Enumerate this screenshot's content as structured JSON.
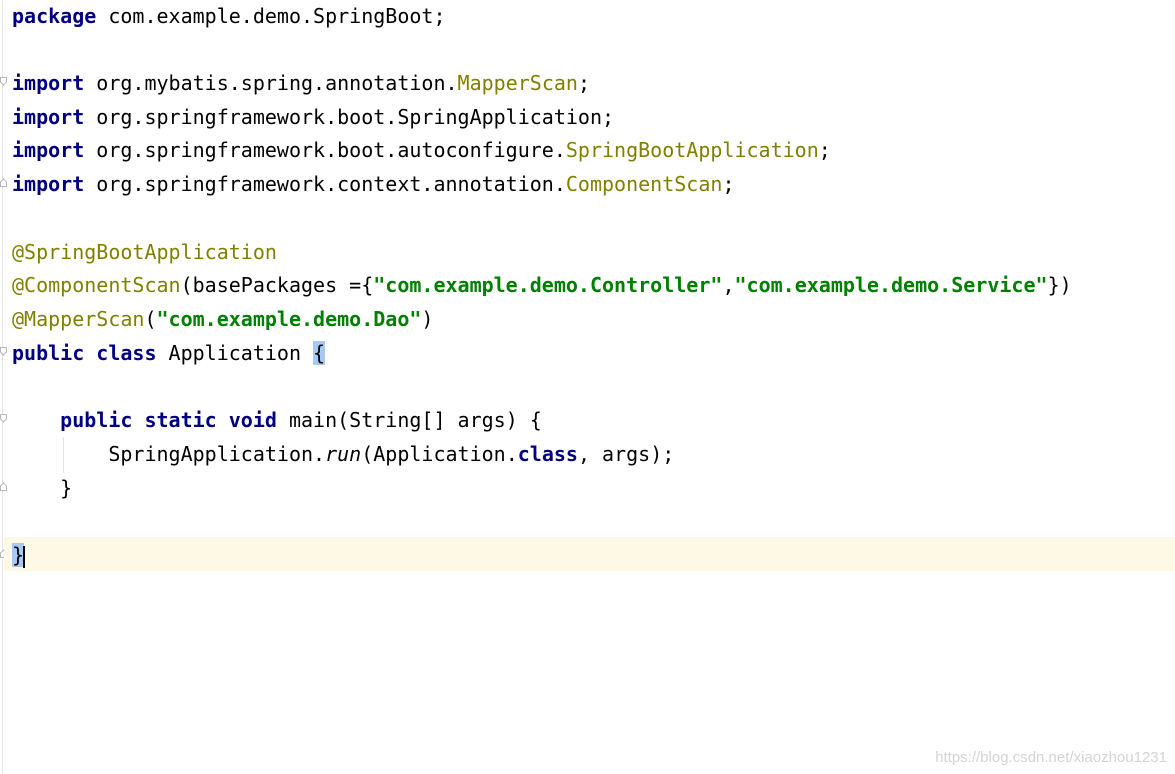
{
  "editor": {
    "package_line": {
      "kw": "package",
      "rest": " com.example.demo.SpringBoot;"
    },
    "imports": [
      {
        "kw": "import",
        "path": " org.mybatis.spring.annotation.",
        "cls": "MapperScan",
        "end": ";"
      },
      {
        "kw": "import",
        "path": " org.springframework.boot.SpringApplication",
        "cls": "",
        "end": ";"
      },
      {
        "kw": "import",
        "path": " org.springframework.boot.autoconfigure.",
        "cls": "SpringBootApplication",
        "end": ";"
      },
      {
        "kw": "import",
        "path": " org.springframework.context.annotation.",
        "cls": "ComponentScan",
        "end": ";"
      }
    ],
    "annotation_spring_boot": "@SpringBootApplication",
    "annotation_component_scan": {
      "name": "@ComponentScan",
      "open": "(basePackages ={",
      "str1": "\"com.example.demo.Controller\"",
      "comma": ",",
      "str2": "\"com.example.demo.Service\"",
      "close": "})"
    },
    "annotation_mapper_scan": {
      "name": "@MapperScan",
      "open": "(",
      "str": "\"com.example.demo.Dao\"",
      "close": ")"
    },
    "class_decl": {
      "kw": "public class",
      "name": " Application ",
      "brace": "{"
    },
    "main_decl": {
      "indent": "    ",
      "kw": "public static void",
      "rest": " main(String[] args) {"
    },
    "run_stmt": {
      "indent": "        ",
      "obj": "SpringApplication.",
      "method": "run",
      "args_open": "(Application.",
      "kw": "class",
      "args_close": ", args);"
    },
    "main_close": "    }",
    "class_close": "}"
  },
  "watermark": "https://blog.csdn.net/xiaozhou1231",
  "colors": {
    "keyword": "#000080",
    "annotation": "#808000",
    "string": "#008000",
    "current_line": "#fdf9e4",
    "brace_highlight": "#a7c8f0"
  }
}
